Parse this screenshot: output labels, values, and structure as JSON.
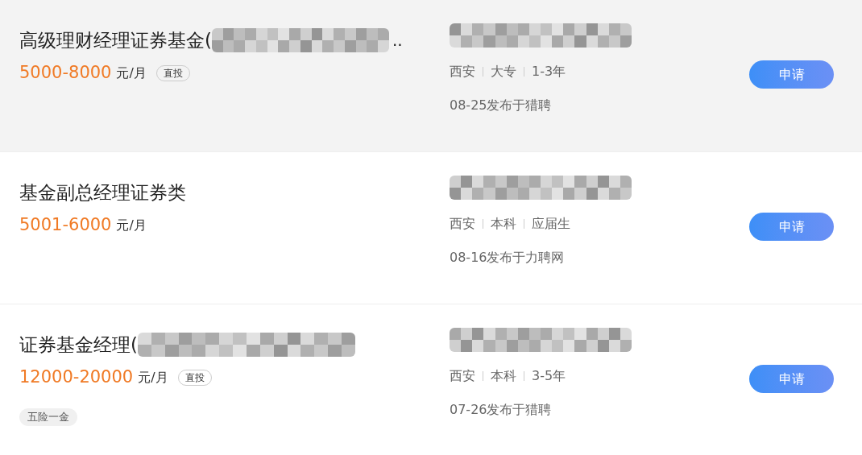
{
  "jobs": [
    {
      "highlighted": true,
      "title": "高级理财经理证券基金(",
      "title_tail": "..",
      "title_masked": true,
      "salary": "5000-8000",
      "unit": "元/月",
      "badge": "直投",
      "company_masked": true,
      "meta": [
        "西安",
        "大专",
        "1-3年"
      ],
      "posted": "08-25发布于猎聘",
      "button": "申请"
    },
    {
      "highlighted": false,
      "title": "基金副总经理证券类",
      "title_masked": false,
      "salary": "5001-6000",
      "unit": "元/月",
      "company_masked": true,
      "meta": [
        "西安",
        "本科",
        "应届生"
      ],
      "posted": "08-16发布于力聘网",
      "button": "申请"
    },
    {
      "highlighted": false,
      "title": "证券基金经理(",
      "title_masked": true,
      "salary": "12000-20000",
      "unit": "元/月",
      "badge": "直投",
      "benefits": [
        "五险一金"
      ],
      "company_masked": true,
      "meta": [
        "西安",
        "本科",
        "3-5年"
      ],
      "posted": "07-26发布于猎聘",
      "button": "申请"
    }
  ]
}
